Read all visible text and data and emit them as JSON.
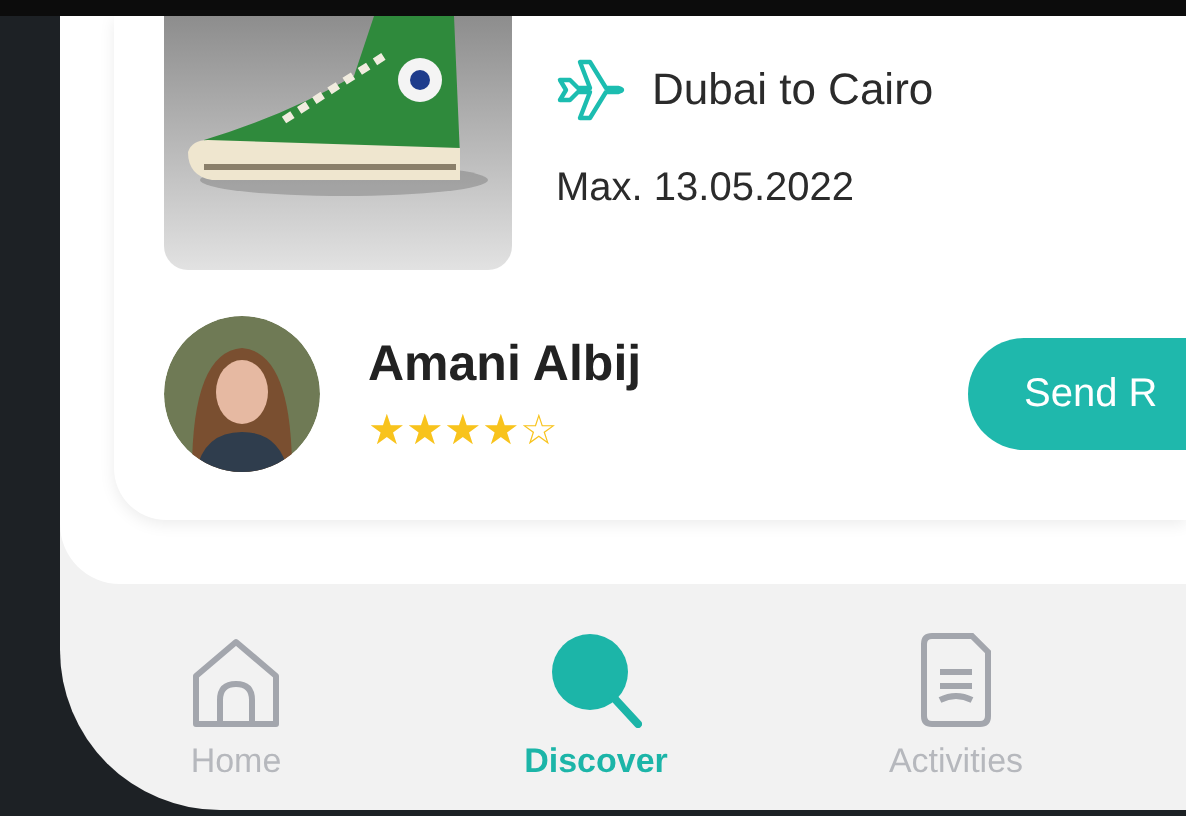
{
  "item": {
    "route": "Dubai to Cairo",
    "deadline": "Max. 13.05.2022"
  },
  "traveler": {
    "name": "Amani Albij",
    "stars": 4,
    "action": "Send R"
  },
  "nav": [
    {
      "kind": "home",
      "label": "Home",
      "selected": false
    },
    {
      "kind": "search",
      "label": "Discover",
      "selected": true
    },
    {
      "kind": "document",
      "label": "Activities",
      "selected": false
    }
  ]
}
